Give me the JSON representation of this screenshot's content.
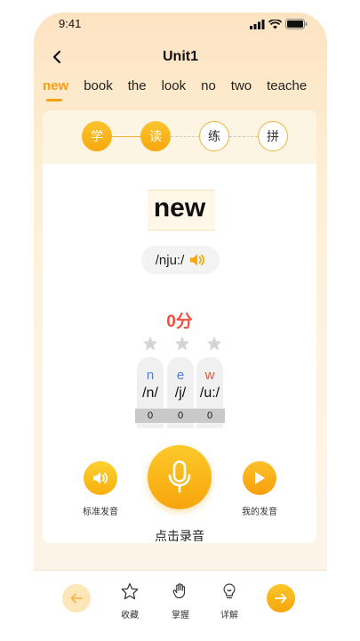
{
  "status_bar": {
    "time": "9:41"
  },
  "header": {
    "title": "Unit1"
  },
  "word_tabs": [
    "new",
    "book",
    "the",
    "look",
    "no",
    "two",
    "teache"
  ],
  "steps": [
    "学",
    "读",
    "练",
    "拼"
  ],
  "word": {
    "text": "new",
    "phonetic": "/nju:/"
  },
  "score": "0分",
  "stars": {
    "filled": 0,
    "total": 3
  },
  "phonemes": [
    {
      "letter": "n",
      "ipa": "/n/",
      "score": "0",
      "color": "#4a7fd8"
    },
    {
      "letter": "e",
      "ipa": "/j/",
      "score": "0",
      "color": "#4a7fd8"
    },
    {
      "letter": "w",
      "ipa": "/u:/",
      "score": "0",
      "color": "#e05545"
    }
  ],
  "actions": {
    "standard_audio_label": "标准发音",
    "my_audio_label": "我的发音",
    "record_label": "点击录音"
  },
  "bottom_nav": {
    "favorite_label": "收藏",
    "master_label": "掌握",
    "detail_label": "详解"
  },
  "colors": {
    "accent": "#f7a80e",
    "score_red": "#f0503d"
  }
}
